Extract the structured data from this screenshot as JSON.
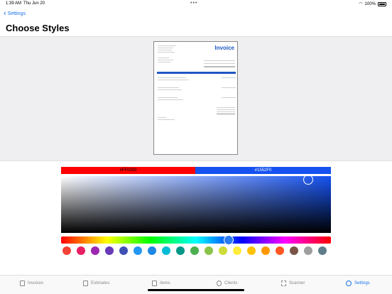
{
  "status_bar": {
    "time": "1:39 AM",
    "date": "Thu Jun 20",
    "dots": "•••",
    "battery": "100%"
  },
  "nav": {
    "back_label": "Settings",
    "title": "Choose Styles"
  },
  "invoice_preview": {
    "title": "Invoice"
  },
  "color_picker": {
    "primary_hex": "#FF0000",
    "secondary_hex": "#1552F0",
    "primary_color": "#ff0000",
    "secondary_color": "#1552f0",
    "swatches": [
      "#f44336",
      "#e91e63",
      "#9c27b0",
      "#673ab7",
      "#3f51b5",
      "#2196f3",
      "#1e88e5",
      "#00bcd4",
      "#009688",
      "#4caf50",
      "#8bc34a",
      "#cddc39",
      "#ffeb3b",
      "#ffc107",
      "#ff9800",
      "#ff5722",
      "#795548",
      "#9e9e9e",
      "#607d8b"
    ]
  },
  "tabs": [
    {
      "label": "Invoices",
      "icon": "invoice-icon"
    },
    {
      "label": "Estimates",
      "icon": "estimate-icon"
    },
    {
      "label": "Items",
      "icon": "items-icon"
    },
    {
      "label": "Clients",
      "icon": "clients-icon"
    },
    {
      "label": "Scanner",
      "icon": "scanner-icon"
    },
    {
      "label": "Settings",
      "icon": "gear-icon"
    }
  ]
}
